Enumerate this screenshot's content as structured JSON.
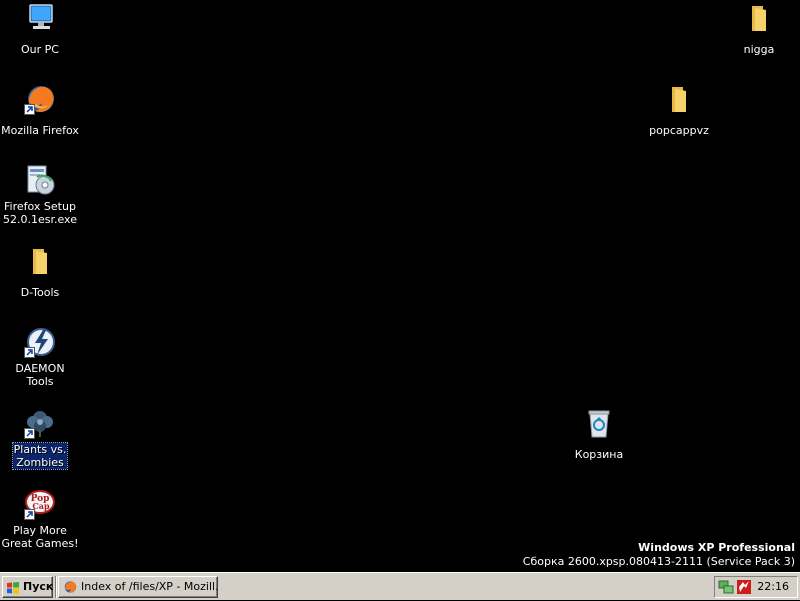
{
  "desktop": {
    "icons": [
      {
        "label": "Our PC",
        "icon": "computer-icon"
      },
      {
        "label": "Mozilla Firefox",
        "icon": "firefox-icon"
      },
      {
        "label": "Firefox Setup\n52.0.1esr.exe",
        "icon": "installer-icon"
      },
      {
        "label": "D-Tools",
        "icon": "folder-icon"
      },
      {
        "label": "DAEMON Tools",
        "icon": "daemon-tools-icon"
      },
      {
        "label": "Plants vs.\nZombies",
        "icon": "plants-vs-zombies-icon",
        "selected": true
      },
      {
        "label": "Play More\nGreat Games!",
        "icon": "popcap-icon"
      },
      {
        "label": "nigga",
        "icon": "folder-icon"
      },
      {
        "label": "popcappvz",
        "icon": "folder-icon"
      },
      {
        "label": "Корзина",
        "icon": "recycle-bin-icon"
      }
    ]
  },
  "watermark": {
    "edition": "Windows XP Professional",
    "build": "Сборка 2600.xpsp.080413-2111 (Service Pack 3)"
  },
  "taskbar": {
    "start_label": "Пуск",
    "tasks": [
      {
        "label": "Index of /files/XP - Mozill...",
        "icon": "firefox-icon"
      }
    ],
    "tray": {
      "icons": [
        "network-icon",
        "antivirus-icon"
      ],
      "clock": "22:16"
    }
  },
  "colors": {
    "desktop_bg": "#000000",
    "taskbar_bg": "#d4d0c8",
    "selection_bg": "#0b246a",
    "text": "#ffffff"
  }
}
